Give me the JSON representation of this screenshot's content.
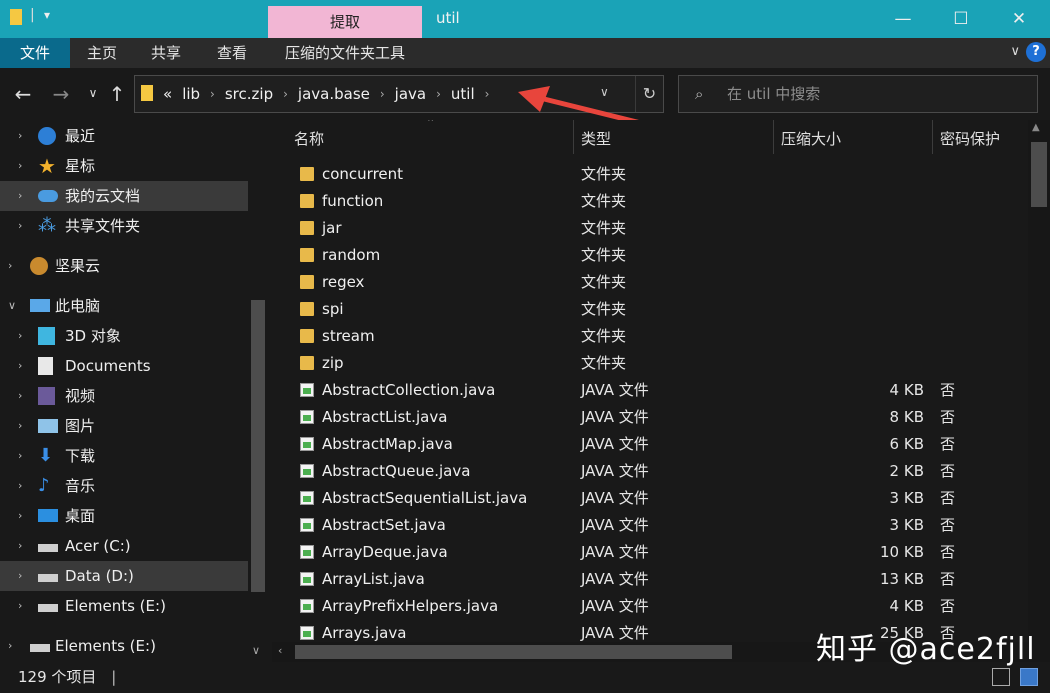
{
  "window": {
    "title": "util",
    "context_tab": "提取",
    "minimize": "—",
    "maximize": "☐",
    "close": "✕"
  },
  "ribbon": {
    "tabs": [
      "文件",
      "主页",
      "共享",
      "查看",
      "压缩的文件夹工具"
    ],
    "help": "?"
  },
  "address": {
    "overflow": "«",
    "crumbs": [
      "lib",
      "src.zip",
      "java.base",
      "java",
      "util"
    ]
  },
  "search": {
    "placeholder": "在 util 中搜索"
  },
  "sidebar": {
    "items": [
      {
        "label": "最近",
        "icon": "clock-icon"
      },
      {
        "label": "星标",
        "icon": "star-icon"
      },
      {
        "label": "我的云文档",
        "icon": "cloud-icon"
      },
      {
        "label": "共享文件夹",
        "icon": "share-icon"
      },
      {
        "label": "坚果云",
        "icon": "nut-icon"
      },
      {
        "label": "此电脑",
        "icon": "computer-icon"
      },
      {
        "label": "3D 对象",
        "icon": "cube-icon"
      },
      {
        "label": "Documents",
        "icon": "document-icon"
      },
      {
        "label": "视频",
        "icon": "video-icon"
      },
      {
        "label": "图片",
        "icon": "picture-icon"
      },
      {
        "label": "下载",
        "icon": "download-icon"
      },
      {
        "label": "音乐",
        "icon": "music-icon"
      },
      {
        "label": "桌面",
        "icon": "desktop-icon"
      },
      {
        "label": "Acer (C:)",
        "icon": "drive-icon"
      },
      {
        "label": "Data (D:)",
        "icon": "drive-icon"
      },
      {
        "label": "Elements (E:)",
        "icon": "drive-icon"
      },
      {
        "label": "Elements (E:)",
        "icon": "drive-icon"
      }
    ]
  },
  "columns": {
    "name": "名称",
    "type": "类型",
    "size": "压缩大小",
    "password": "密码保护"
  },
  "files": [
    {
      "name": "concurrent",
      "type": "文件夹",
      "size": "",
      "password": "",
      "kind": "folder"
    },
    {
      "name": "function",
      "type": "文件夹",
      "size": "",
      "password": "",
      "kind": "folder"
    },
    {
      "name": "jar",
      "type": "文件夹",
      "size": "",
      "password": "",
      "kind": "folder"
    },
    {
      "name": "random",
      "type": "文件夹",
      "size": "",
      "password": "",
      "kind": "folder"
    },
    {
      "name": "regex",
      "type": "文件夹",
      "size": "",
      "password": "",
      "kind": "folder"
    },
    {
      "name": "spi",
      "type": "文件夹",
      "size": "",
      "password": "",
      "kind": "folder"
    },
    {
      "name": "stream",
      "type": "文件夹",
      "size": "",
      "password": "",
      "kind": "folder"
    },
    {
      "name": "zip",
      "type": "文件夹",
      "size": "",
      "password": "",
      "kind": "folder"
    },
    {
      "name": "AbstractCollection.java",
      "type": "JAVA 文件",
      "size": "4 KB",
      "password": "否",
      "kind": "java"
    },
    {
      "name": "AbstractList.java",
      "type": "JAVA 文件",
      "size": "8 KB",
      "password": "否",
      "kind": "java"
    },
    {
      "name": "AbstractMap.java",
      "type": "JAVA 文件",
      "size": "6 KB",
      "password": "否",
      "kind": "java"
    },
    {
      "name": "AbstractQueue.java",
      "type": "JAVA 文件",
      "size": "2 KB",
      "password": "否",
      "kind": "java"
    },
    {
      "name": "AbstractSequentialList.java",
      "type": "JAVA 文件",
      "size": "3 KB",
      "password": "否",
      "kind": "java"
    },
    {
      "name": "AbstractSet.java",
      "type": "JAVA 文件",
      "size": "3 KB",
      "password": "否",
      "kind": "java"
    },
    {
      "name": "ArrayDeque.java",
      "type": "JAVA 文件",
      "size": "10 KB",
      "password": "否",
      "kind": "java"
    },
    {
      "name": "ArrayList.java",
      "type": "JAVA 文件",
      "size": "13 KB",
      "password": "否",
      "kind": "java"
    },
    {
      "name": "ArrayPrefixHelpers.java",
      "type": "JAVA 文件",
      "size": "4 KB",
      "password": "否",
      "kind": "java"
    },
    {
      "name": "Arrays.java",
      "type": "JAVA 文件",
      "size": "25 KB",
      "password": "否",
      "kind": "java"
    }
  ],
  "status": {
    "count": "129 个项目"
  },
  "watermark": "知乎 @ace2fjll",
  "colors": {
    "titlebar": "#1aa3b7",
    "context_tab": "#f2b6d4",
    "file_tab": "#0a6a8c",
    "arrow": "#e8453c"
  }
}
